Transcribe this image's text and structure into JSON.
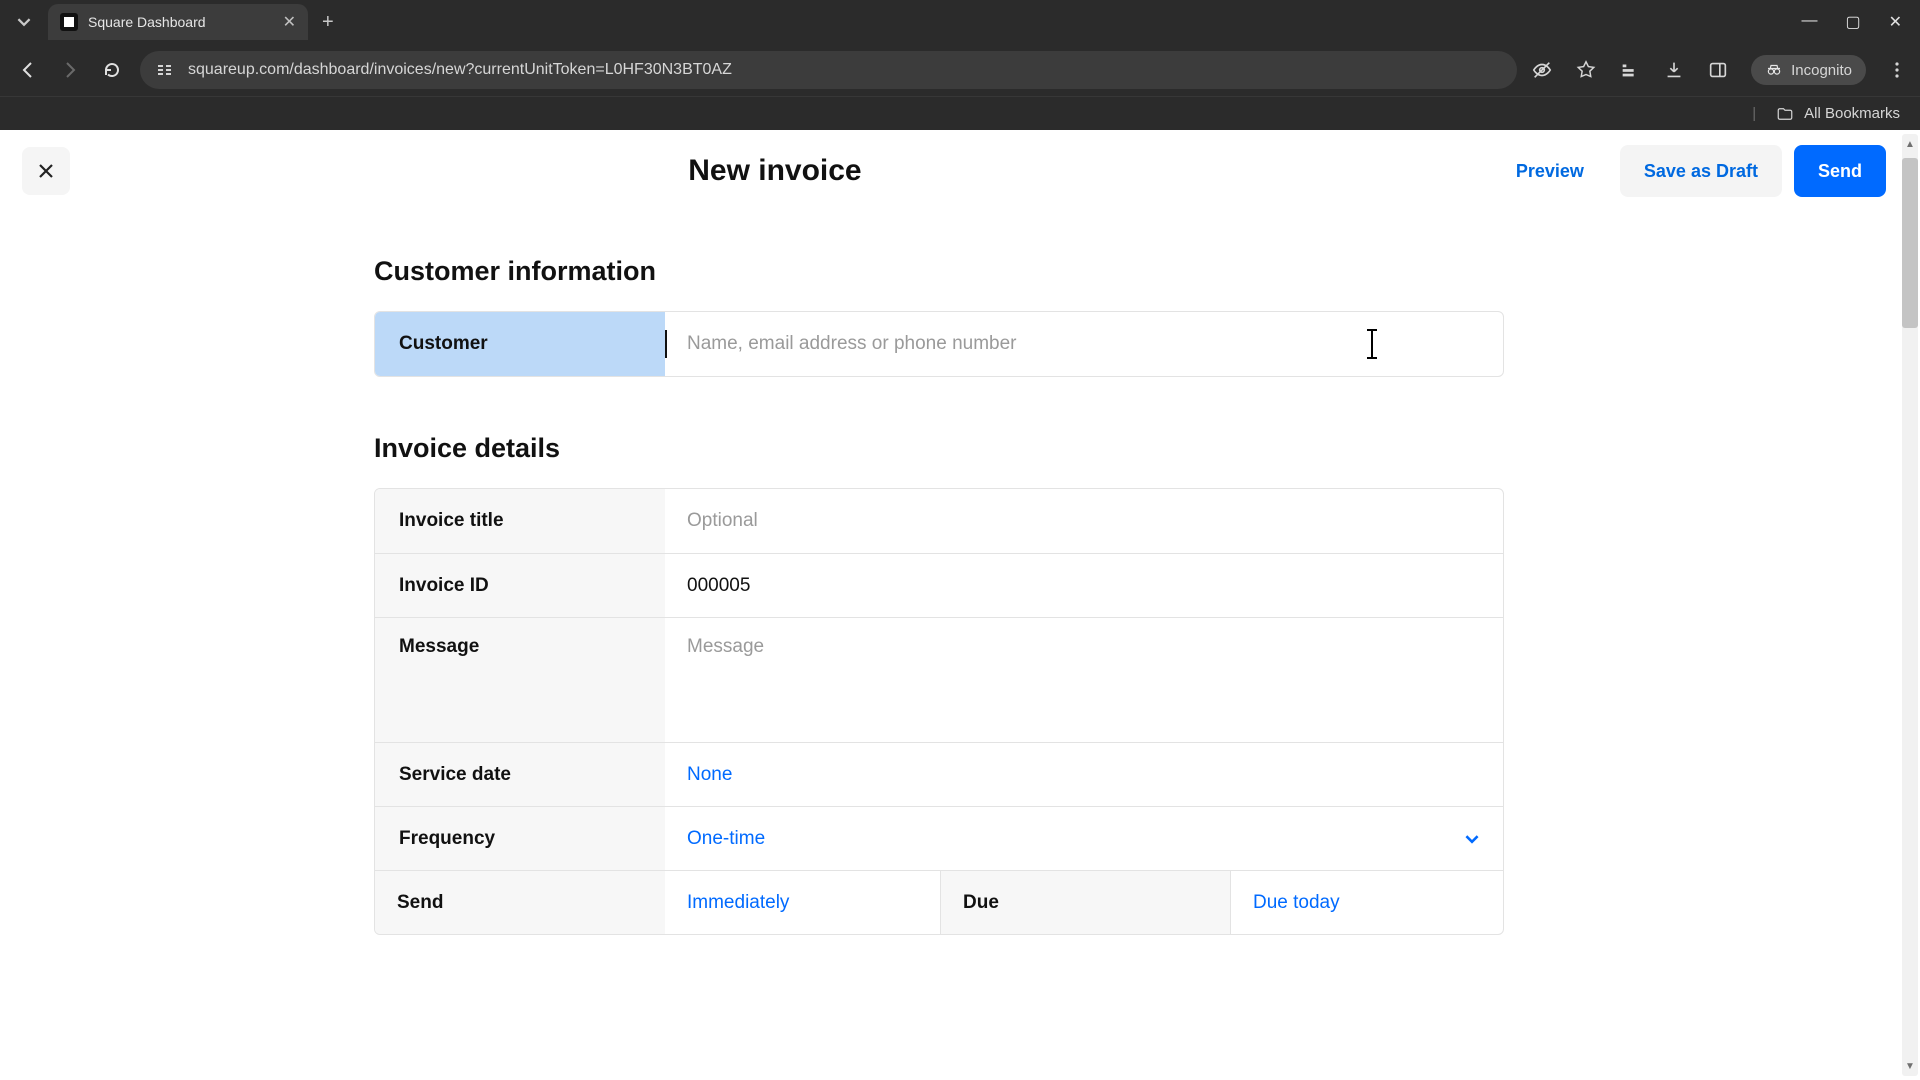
{
  "browser": {
    "tab_title": "Square Dashboard",
    "url": "squareup.com/dashboard/invoices/new?currentUnitToken=L0HF30N3BT0AZ",
    "incognito_label": "Incognito",
    "bookmarks_label": "All Bookmarks"
  },
  "header": {
    "title": "New invoice",
    "preview_label": "Preview",
    "save_draft_label": "Save as Draft",
    "send_label": "Send"
  },
  "sections": {
    "customer_info_title": "Customer information",
    "invoice_details_title": "Invoice details"
  },
  "fields": {
    "customer": {
      "label": "Customer",
      "placeholder": "Name, email address or phone number",
      "value": ""
    },
    "invoice_title": {
      "label": "Invoice title",
      "placeholder": "Optional",
      "value": ""
    },
    "invoice_id": {
      "label": "Invoice ID",
      "value": "000005"
    },
    "message": {
      "label": "Message",
      "placeholder": "Message",
      "value": ""
    },
    "service_date": {
      "label": "Service date",
      "value": "None"
    },
    "frequency": {
      "label": "Frequency",
      "value": "One-time"
    },
    "send": {
      "label": "Send",
      "value": "Immediately"
    },
    "due": {
      "label": "Due",
      "value": "Due today"
    }
  }
}
